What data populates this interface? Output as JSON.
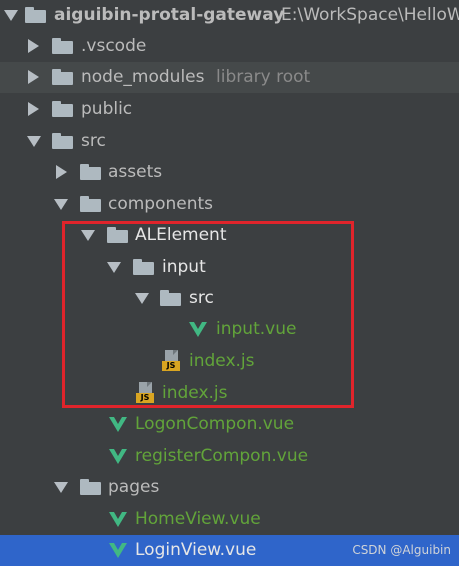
{
  "tree": {
    "root": {
      "name": "aiguibin-protal-gateway",
      "path": "E:\\WorkSpace\\HelloW"
    },
    "vscode": ".vscode",
    "node_modules": {
      "name": "node_modules",
      "hint": "library root"
    },
    "public": "public",
    "src": "src",
    "assets": "assets",
    "components": "components",
    "alelement": "ALElement",
    "input": "input",
    "input_src": "src",
    "input_vue": "input.vue",
    "input_index_js": "index.js",
    "alelement_index_js": "index.js",
    "logon_compon": "LogonCompon.vue",
    "register_compon": "registerCompon.vue",
    "pages": "pages",
    "home_view": "HomeView.vue",
    "login_view": "LoginView.vue"
  },
  "watermark": "CSDN @Alguibin",
  "colors": {
    "background": "#3c3f41",
    "selection": "#2f65ca",
    "vue_file": "#62a43a",
    "highlight_box": "#e0242b"
  }
}
